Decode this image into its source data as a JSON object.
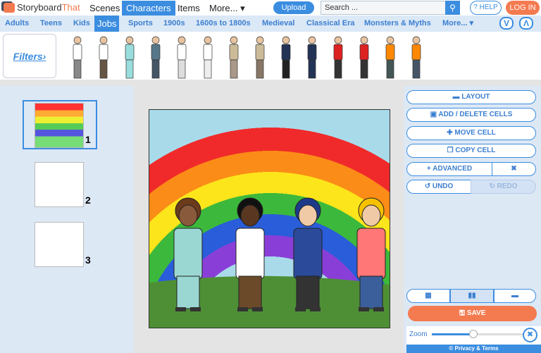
{
  "header": {
    "logo": "Storyboard",
    "logo2": "That",
    "nav": [
      "Scenes",
      "Characters",
      "Items",
      "More... ▾"
    ],
    "upload": "Upload",
    "search_placeholder": "Search ...",
    "help": "? HELP",
    "login": "LOG IN"
  },
  "categories": [
    "Adults",
    "Teens",
    "Kids",
    "Jobs",
    "Sports",
    "1900s",
    "1600s to 1800s",
    "Medieval",
    "Classical Era",
    "Monsters & Myths",
    "More... ▾"
  ],
  "filters": "Filters›",
  "thumbnails": [
    "1",
    "2",
    "3"
  ],
  "tools": {
    "layout": "LAYOUT",
    "add_delete": "ADD / DELETE CELLS",
    "move": "MOVE CELL",
    "copy": "COPY CELL",
    "advanced": "ADVANCED",
    "undo": "UNDO",
    "redo": "REDO",
    "save": "SAVE",
    "zoom": "Zoom",
    "footer": "© Privacy & Terms"
  },
  "zoom_level": 0.45,
  "colors": {
    "accent": "#3b8de0",
    "orange": "#f47a50"
  }
}
